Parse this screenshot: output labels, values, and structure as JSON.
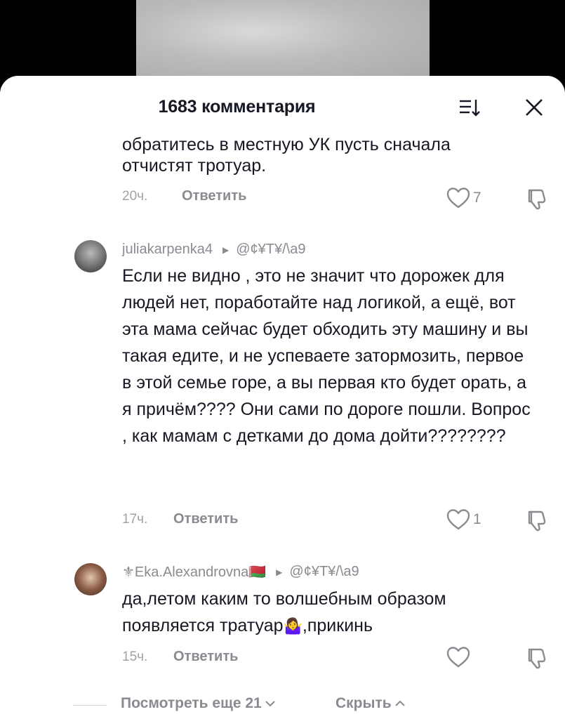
{
  "header": {
    "title": "1683 комментария"
  },
  "comments": [
    {
      "partial_top": "обратитесь в местную УК пусть сначала",
      "text": "отчистят тротуар.",
      "time": "20ч.",
      "reply": "Ответить",
      "likes": "7"
    },
    {
      "username": "juliakarpenka4",
      "reply_to": "@¢¥T¥/\\a9",
      "text": "Если не видно , это не значит что дорожек для людей нет, поработайте над логикой, а ещё, вот эта мама сейчас будет обходить эту машину и вы такая едите, и не успеваете затормозить, первое в этой семье горе, а вы первая кто будет орать, а я причём???? Они сами по дороге пошли. Вопрос , как мамам с детками до дома дойти????????",
      "time": "17ч.",
      "reply": "Ответить",
      "likes": "1"
    },
    {
      "username": "⚜Eka.Alexandrovna🇧🇾",
      "reply_to": "@¢¥T¥/\\a9",
      "text_line1": "да,летом каким то волшебным образом",
      "text_line2_a": "появляется тратуар",
      "text_emoji": "🤷‍♀️",
      "text_line2_b": ",прикинь",
      "time": "15ч.",
      "reply": "Ответить",
      "likes": ""
    }
  ],
  "footer": {
    "more": "Посмотреть еще 21",
    "hide": "Скрыть"
  },
  "colors": {
    "text": "#161823",
    "muted": "#8a8b91",
    "background": "#ffffff"
  }
}
